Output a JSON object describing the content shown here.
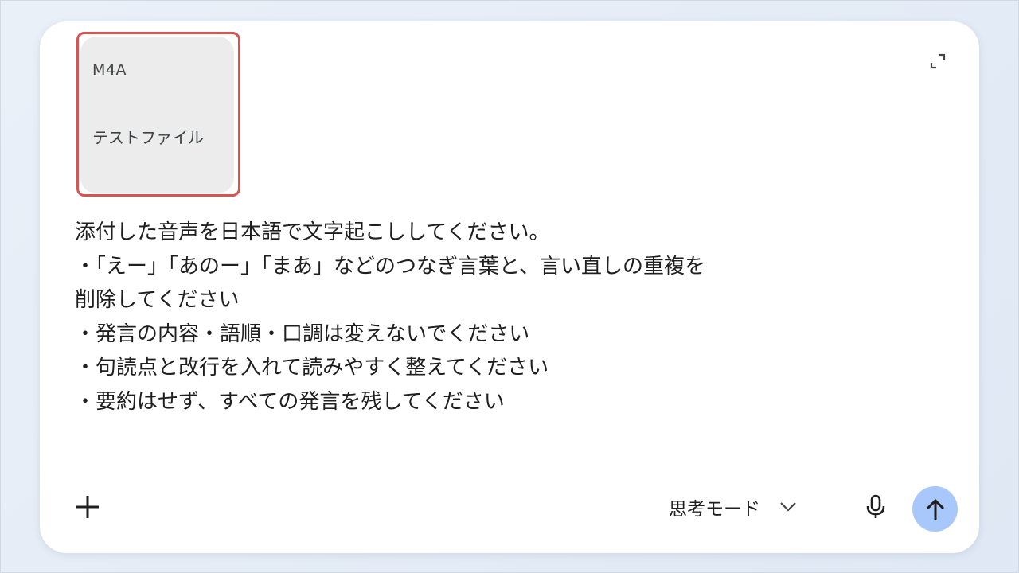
{
  "attachment": {
    "file_type": "M4A",
    "file_name": "テストファイル"
  },
  "prompt": {
    "text": "添付した音声を日本語で文字起こししてください。\n・「えー」「あのー」「まあ」などのつなぎ言葉と、言い直しの重複を\n削除してください\n・発言の内容・語順・口調は変えないでください\n・句読点と改行を入れて読みやすく整えてください\n・要約はせず、すべての発言を残してください"
  },
  "toolbar": {
    "mode_label": "思考モード"
  },
  "icons": {
    "expand": "expand-icon",
    "add": "plus-icon",
    "mode_dropdown": "chevron-down-icon",
    "mic": "microphone-icon",
    "send": "arrow-up-icon"
  },
  "colors": {
    "send_button": "#a8c7fa",
    "attachment_chip": "#ececec",
    "highlight": "#d9534f"
  }
}
